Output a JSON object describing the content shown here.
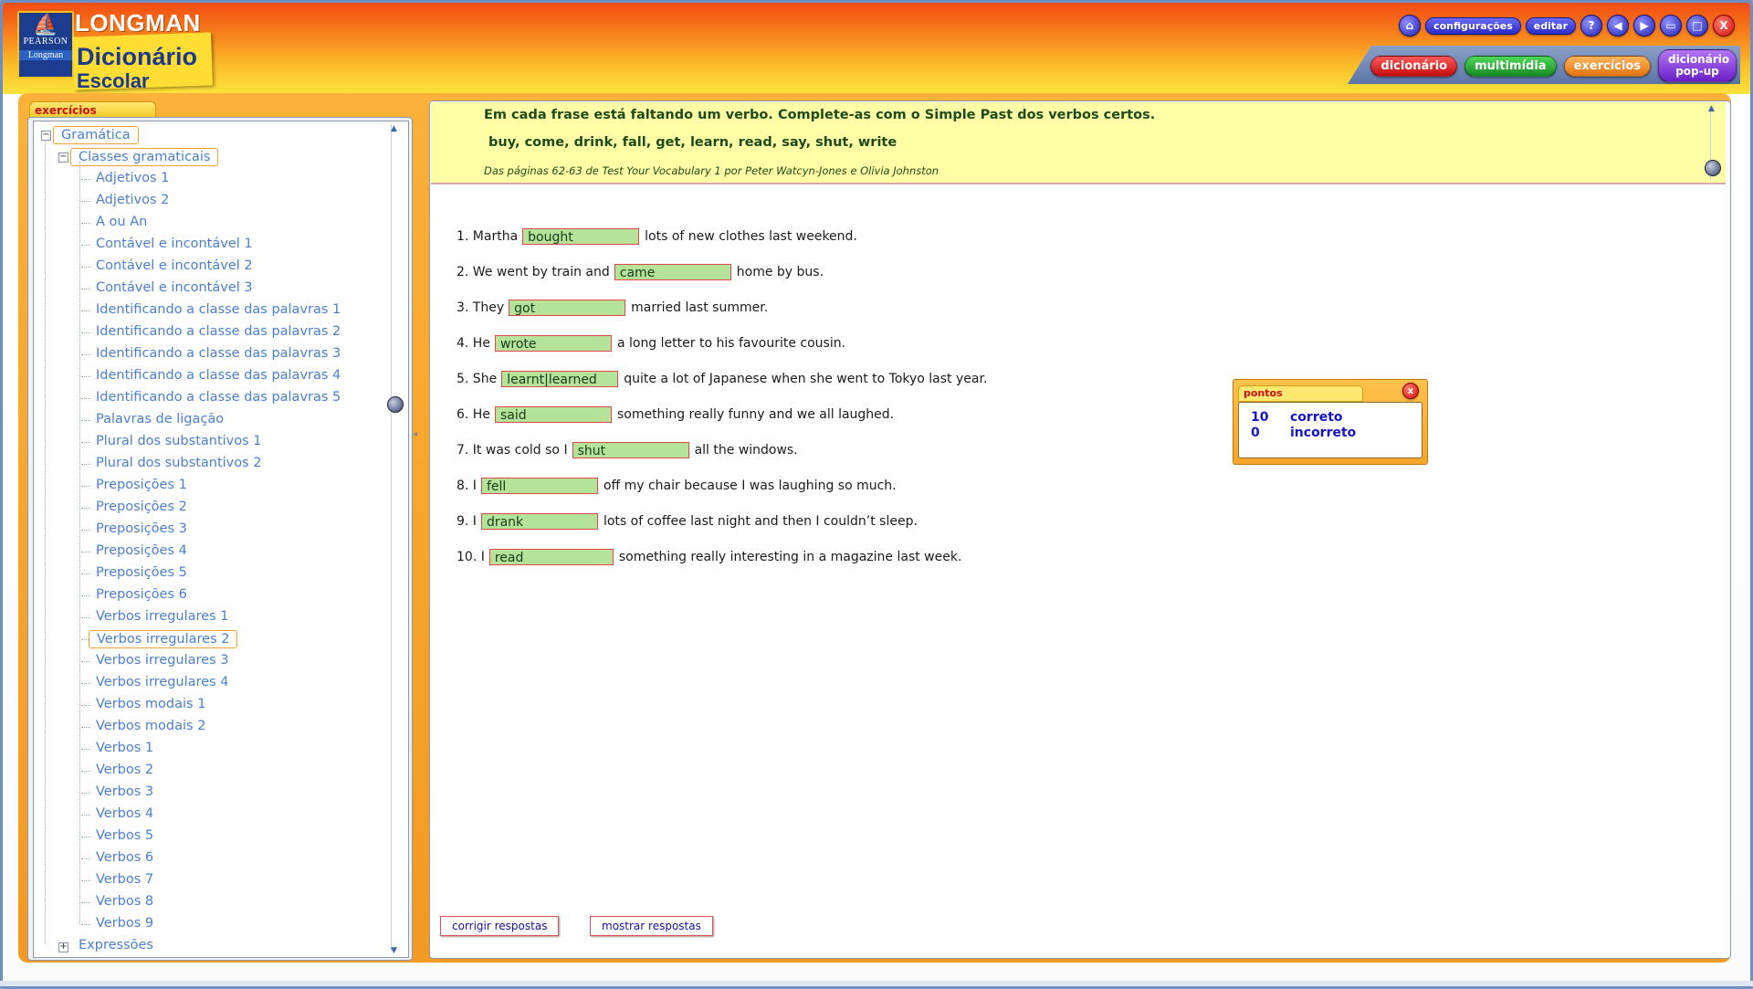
{
  "header": {
    "brand_top": "LONGMAN",
    "brand_line1": "Dicionário",
    "brand_line2": "Escolar",
    "logo_pearson": "PEARSON",
    "logo_longman": "Longman"
  },
  "toolbar": {
    "home_icon": "home-icon",
    "configuracoes": "configurações",
    "editar": "editar",
    "help": "?",
    "back": "◀",
    "forward": "▶",
    "close": "X"
  },
  "tabs": {
    "dicionario": "dicionário",
    "multimidia": "multimídia",
    "exercicios": "exercícios",
    "popup_line1": "dicionário",
    "popup_line2": "pop-up"
  },
  "sidebar": {
    "tab_label": "exercícios",
    "root": "Gramática",
    "group": "Classes gramaticais",
    "items": [
      "Adjetivos 1",
      "Adjetivos 2",
      "A ou An",
      "Contável e incontável 1",
      "Contável e incontável 2",
      "Contável e incontável 3",
      "Identificando a classe das palavras 1",
      "Identificando a classe das palavras 2",
      "Identificando a classe das palavras 3",
      "Identificando a classe das palavras 4",
      "Identificando a classe das palavras 5",
      "Palavras de ligação",
      "Plural dos substantivos 1",
      "Plural dos substantivos 2",
      "Preposições 1",
      "Preposições 2",
      "Preposições 3",
      "Preposições 4",
      "Preposições 5",
      "Preposições 6",
      "Verbos irregulares 1",
      "Verbos irregulares 2",
      "Verbos irregulares 3",
      "Verbos irregulares 4",
      "Verbos modais 1",
      "Verbos modais 2",
      "Verbos 1",
      "Verbos 2",
      "Verbos 3",
      "Verbos 4",
      "Verbos 5",
      "Verbos 6",
      "Verbos 7",
      "Verbos 8",
      "Verbos 9"
    ],
    "selected_item": "Verbos irregulares 2",
    "collapsed": "Expressões"
  },
  "exercise": {
    "instruction": "Em cada frase está faltando um verbo. Complete-as com o Simple Past dos verbos certos.",
    "word_list": "buy, come, drink, fall, get, learn, read, say, shut, write",
    "credit": "Das páginas 62-63 de Test Your Vocabulary 1 por Peter Watcyn-Jones e Olivia Johnston",
    "questions": [
      {
        "pre": "1. Martha",
        "answer": "bought",
        "post": "lots of new clothes last weekend."
      },
      {
        "pre": "2. We went by train and",
        "answer": "came",
        "post": "home by bus."
      },
      {
        "pre": "3. They",
        "answer": "got",
        "post": "married last summer."
      },
      {
        "pre": "4. He",
        "answer": "wrote",
        "post": "a long letter to his favourite cousin."
      },
      {
        "pre": "5. She",
        "answer": "learnt|learned",
        "post": "quite a lot of Japanese when she went to Tokyo last year."
      },
      {
        "pre": "6. He",
        "answer": "said",
        "post": "something really funny and we all laughed."
      },
      {
        "pre": "7. It was cold so I",
        "answer": "shut",
        "post": "all the windows."
      },
      {
        "pre": "8. I",
        "answer": "fell",
        "post": "off my chair because I was laughing so much."
      },
      {
        "pre": "9. I",
        "answer": "drank",
        "post": "lots of coffee last night and then I couldn’t sleep."
      },
      {
        "pre": "10. I",
        "answer": "read",
        "post": "something really interesting in a magazine last week."
      }
    ],
    "check_button": "corrigir respostas",
    "show_button": "mostrar respostas"
  },
  "score": {
    "title": "pontos",
    "close": "x",
    "correct_count": "10",
    "correct_label": "correto",
    "incorrect_count": "0",
    "incorrect_label": "incorreto"
  },
  "colors": {
    "answer_fill": "#b5e399",
    "answer_border": "#e24646",
    "tree_link": "#4a7fd0",
    "score_text": "#1414c8"
  }
}
